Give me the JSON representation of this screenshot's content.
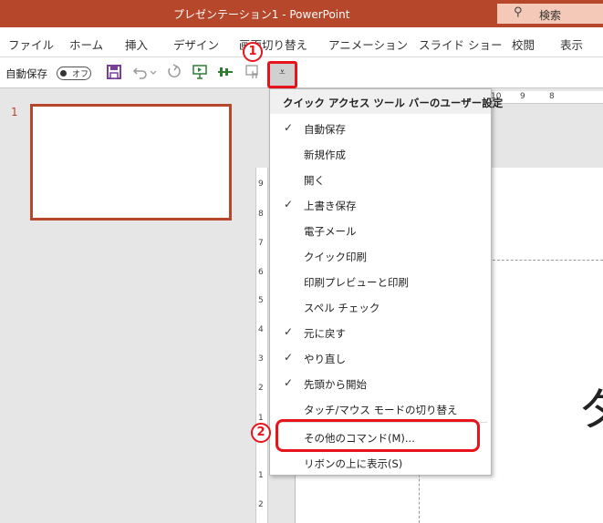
{
  "window": {
    "title": "プレゼンテーション1  -  PowerPoint",
    "search_label": "検索"
  },
  "ribbon": {
    "tabs": [
      "ファイル",
      "ホーム",
      "挿入",
      "デザイン",
      "画面切り替え",
      "アニメーション",
      "スライド ショー",
      "校閲",
      "表示"
    ]
  },
  "qat": {
    "autosave_label": "自動保存",
    "autosave_state": "オフ",
    "dropdown_glyph": "⩡"
  },
  "slides": {
    "current_number": "1"
  },
  "rulers": {
    "vertical": [
      "9",
      "8",
      "7",
      "6",
      "5",
      "4",
      "3",
      "2",
      "1",
      "1",
      "2"
    ],
    "horizontal": [
      "10",
      "9",
      "8"
    ]
  },
  "slide_text": "タ",
  "menu": {
    "header": "クイック アクセス ツール バーのユーザー設定",
    "items": [
      {
        "label": "自動保存",
        "checked": "✓"
      },
      {
        "label": "新規作成",
        "checked": ""
      },
      {
        "label": "開く",
        "checked": ""
      },
      {
        "label": "上書き保存",
        "checked": "✓"
      },
      {
        "label": "電子メール",
        "checked": ""
      },
      {
        "label": "クイック印刷",
        "checked": ""
      },
      {
        "label": "印刷プレビューと印刷",
        "checked": ""
      },
      {
        "label": "スペル チェック",
        "checked": ""
      },
      {
        "label": "元に戻す",
        "checked": "✓"
      },
      {
        "label": "やり直し",
        "checked": "✓"
      },
      {
        "label": "先頭から開始",
        "checked": "✓"
      },
      {
        "label": "タッチ/マウス モードの切り替え",
        "checked": ""
      },
      {
        "label": "その他のコマンド(M)...",
        "checked": ""
      },
      {
        "label": "リボンの上に表示(S)",
        "checked": ""
      }
    ]
  },
  "annotations": {
    "step1": "1",
    "step2": "2"
  },
  "colors": {
    "brand": "#b7472a",
    "highlight": "#e8141b"
  }
}
